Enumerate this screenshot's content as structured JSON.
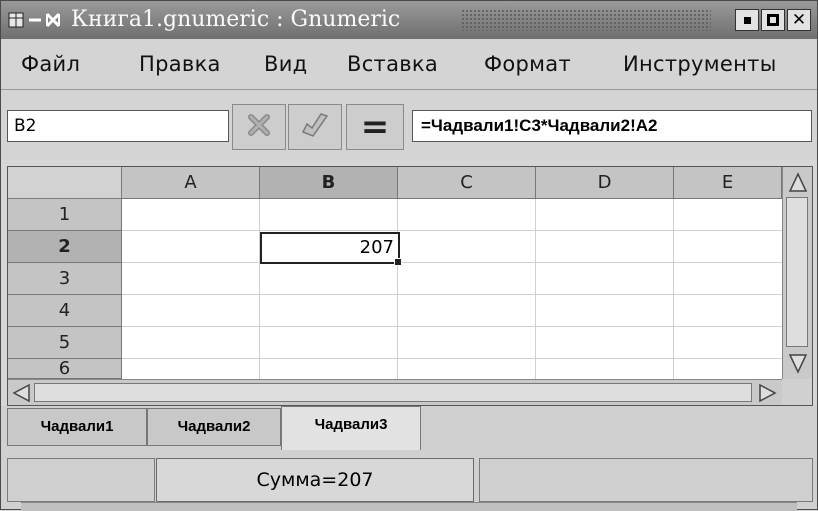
{
  "window": {
    "title": "Книга1.gnumeric : Gnumeric",
    "app_icon": "spreadsheet-icon",
    "buttons": [
      "minimize-icon",
      "maximize-icon",
      "close-icon"
    ]
  },
  "menu": {
    "items": [
      "Файл",
      "Правка",
      "Вид",
      "Вставка",
      "Формат",
      "Инструменты"
    ]
  },
  "formula_bar": {
    "name_box": "B2",
    "cancel_icon": "cancel-icon",
    "accept_icon": "accept-icon",
    "equals_label": "=",
    "formula": "=Чадвали1!C3*Чадвали2!A2"
  },
  "grid": {
    "columns": [
      "A",
      "B",
      "C",
      "D",
      "E"
    ],
    "rows": [
      "1",
      "2",
      "3",
      "4",
      "5",
      "6"
    ],
    "selected_column": "B",
    "selected_row": "2",
    "cells": {
      "B2": "207"
    }
  },
  "sheets": {
    "tabs": [
      "Чадвали1",
      "Чадвали2",
      "Чадвали3"
    ],
    "active": "Чадвали3"
  },
  "status": {
    "sum": "Сумма=207"
  }
}
